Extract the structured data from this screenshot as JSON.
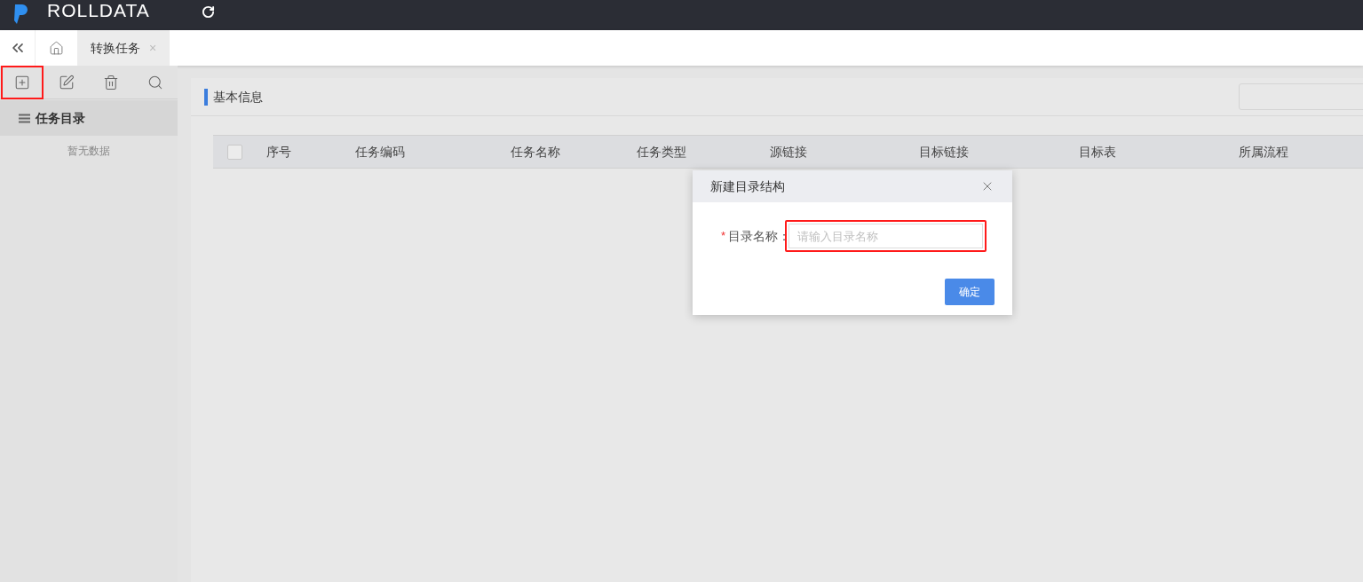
{
  "header": {
    "brand": "ROLLDATA"
  },
  "tabs": [
    {
      "label": "转换任务",
      "selected": true,
      "close": "×"
    }
  ],
  "sidebar": {
    "tools": [
      {
        "kind": "add",
        "highlighted": true
      },
      {
        "kind": "edit",
        "highlighted": false
      },
      {
        "kind": "delete",
        "highlighted": false
      },
      {
        "kind": "search",
        "highlighted": false
      }
    ],
    "title": "任务目录",
    "empty": "暂无数据"
  },
  "main": {
    "section_title": "基本信息",
    "table": {
      "select_all": {
        "checked": false
      },
      "columns": [
        "序号",
        "任务编码",
        "任务名称",
        "任务类型",
        "源链接",
        "目标链接",
        "目标表",
        "所属流程"
      ]
    }
  },
  "dialog": {
    "title": "新建目录结构",
    "field": {
      "label": "目录名称：",
      "required_mark": "*",
      "placeholder": "请输入目录名称",
      "highlighted": true
    },
    "button": "确定"
  }
}
